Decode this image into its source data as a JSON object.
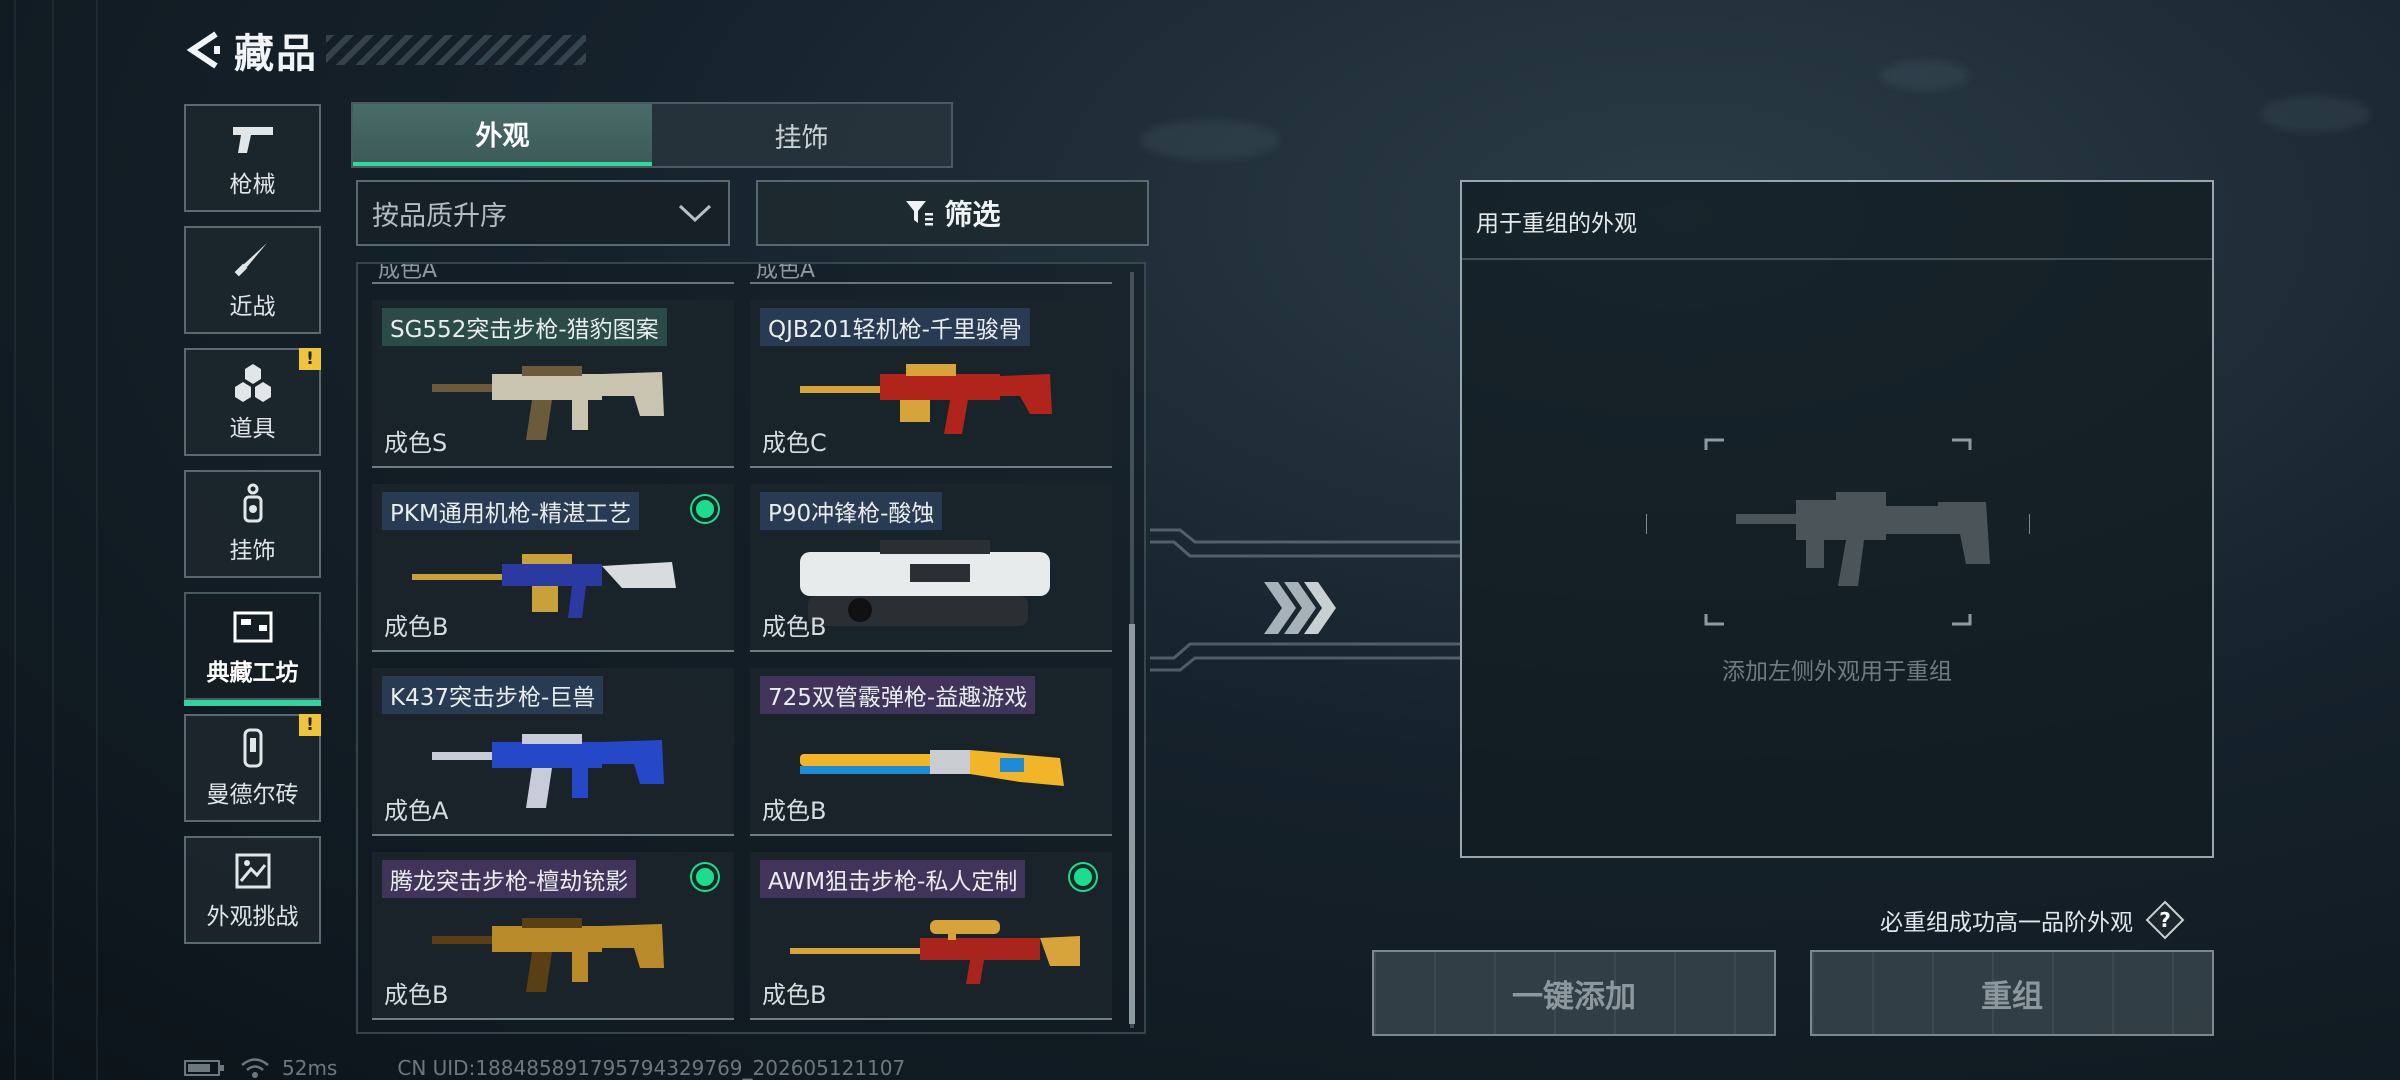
{
  "header": {
    "title": "藏品"
  },
  "categories": [
    {
      "label": "枪械",
      "icon": "pistol-icon",
      "active": false,
      "alert": false
    },
    {
      "label": "近战",
      "icon": "knife-icon",
      "active": false,
      "alert": false
    },
    {
      "label": "道具",
      "icon": "grenades-icon",
      "active": false,
      "alert": true
    },
    {
      "label": "挂饰",
      "icon": "charm-icon",
      "active": false,
      "alert": false
    },
    {
      "label": "典藏工坊",
      "icon": "workshop-icon",
      "active": true,
      "alert": false
    },
    {
      "label": "曼德尔砖",
      "icon": "brick-icon",
      "active": false,
      "alert": true
    },
    {
      "label": "外观挑战",
      "icon": "challenge-icon",
      "active": false,
      "alert": false
    }
  ],
  "alert_mark": "!",
  "tabs": [
    {
      "label": "外观",
      "active": true
    },
    {
      "label": "挂饰",
      "active": false
    }
  ],
  "sort": {
    "value": "按品质升序"
  },
  "filter": {
    "label": "筛选"
  },
  "list": {
    "partial_label": "成色A",
    "items": [
      {
        "name": "SG552突击步枪-猎豹图案",
        "grade": "成色S",
        "quality": "green",
        "equipped": false,
        "gun": "rifle-icon",
        "colors": [
          "#c9c4b0",
          "#6b5b3a"
        ]
      },
      {
        "name": "QJB201轻机枪-千里骏骨",
        "grade": "成色C",
        "quality": "blue",
        "equipped": false,
        "gun": "lmg-icon",
        "colors": [
          "#b0241c",
          "#d6a43a"
        ]
      },
      {
        "name": "PKM通用机枪-精湛工艺",
        "grade": "成色B",
        "quality": "blue",
        "equipped": true,
        "gun": "machine-gun-icon",
        "colors": [
          "#2a3aa0",
          "#c9a13a"
        ]
      },
      {
        "name": "P90冲锋枪-酸蚀",
        "grade": "成色B",
        "quality": "blue",
        "equipped": false,
        "gun": "smg-icon",
        "colors": [
          "#e8ebec",
          "#2a2f33"
        ]
      },
      {
        "name": "K437突击步枪-巨兽",
        "grade": "成色A",
        "quality": "blue",
        "equipped": false,
        "gun": "rifle-icon",
        "colors": [
          "#2448c8",
          "#c7ccd8"
        ]
      },
      {
        "name": "725双管霰弹枪-益趣游戏",
        "grade": "成色B",
        "quality": "purple",
        "equipped": false,
        "gun": "shotgun-icon",
        "colors": [
          "#f2b428",
          "#1f8ad6"
        ]
      },
      {
        "name": "腾龙突击步枪-檀劫铳影",
        "grade": "成色B",
        "quality": "purple",
        "equipped": true,
        "gun": "rifle-icon",
        "colors": [
          "#b88a2a",
          "#5b3f14"
        ]
      },
      {
        "name": "AWM狙击步枪-私人定制",
        "grade": "成色B",
        "quality": "purple",
        "equipped": true,
        "gun": "sniper-icon",
        "colors": [
          "#a8241c",
          "#d6a43a"
        ]
      }
    ]
  },
  "reforge": {
    "title": "用于重组的外观",
    "hint": "添加左侧外观用于重组",
    "guarantee": "必重组成功高一品阶外观",
    "help": "?",
    "add_all_label": "一键添加",
    "reforge_label": "重组"
  },
  "status": {
    "ping": "52ms",
    "uid": "CN UID:18848589179579432976​9_202605121107"
  }
}
